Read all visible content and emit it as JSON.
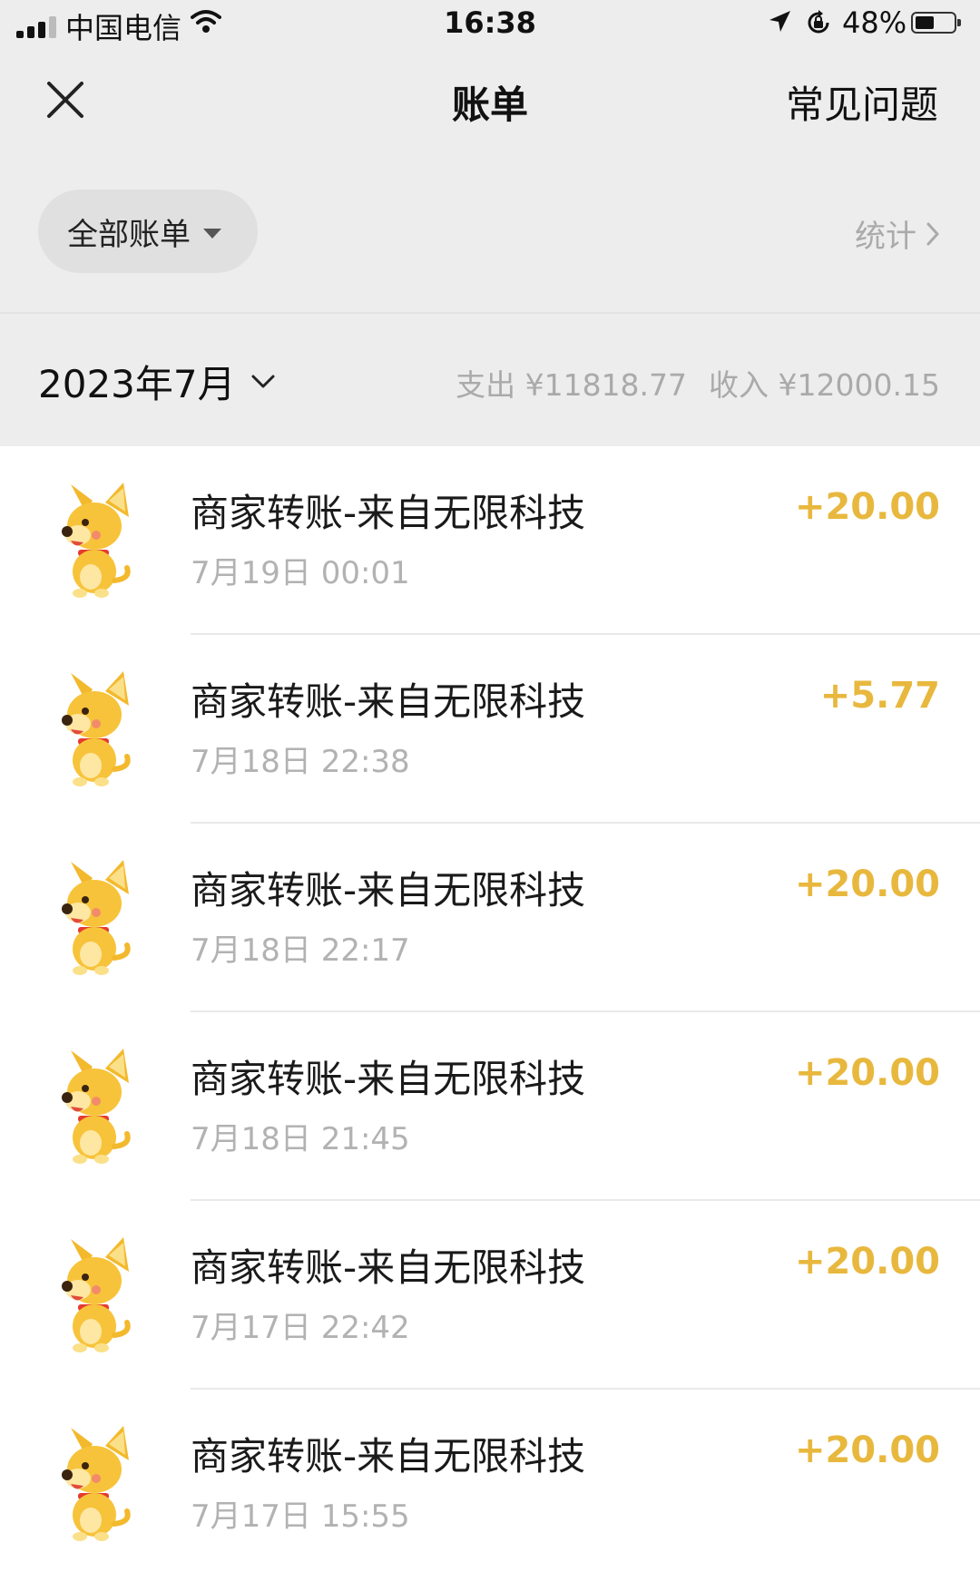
{
  "status_bar": {
    "carrier": "中国电信",
    "time": "16:38",
    "battery": "48%"
  },
  "nav": {
    "title": "账单",
    "faq": "常见问题"
  },
  "filter": {
    "label": "全部账单",
    "stats": "统计"
  },
  "month_bar": {
    "month": "2023年7月",
    "expense": "支出 ¥11818.77",
    "income": "收入 ¥12000.15"
  },
  "transactions": [
    {
      "title": "商家转账-来自无限科技",
      "time": "7月19日 00:01",
      "amount": "+20.00"
    },
    {
      "title": "商家转账-来自无限科技",
      "time": "7月18日 22:38",
      "amount": "+5.77"
    },
    {
      "title": "商家转账-来自无限科技",
      "time": "7月18日 22:17",
      "amount": "+20.00"
    },
    {
      "title": "商家转账-来自无限科技",
      "time": "7月18日 21:45",
      "amount": "+20.00"
    },
    {
      "title": "商家转账-来自无限科技",
      "time": "7月17日 22:42",
      "amount": "+20.00"
    },
    {
      "title": "商家转账-来自无限科技",
      "time": "7月17日 15:55",
      "amount": "+20.00"
    }
  ],
  "colors": {
    "income_amount": "#e8b83e",
    "header_bg": "#ededed",
    "muted_text": "#aaaaaa"
  },
  "icons": [
    "signal-icon",
    "wifi-icon",
    "location-arrow-icon",
    "rotation-lock-icon",
    "battery-icon",
    "close-icon",
    "chevron-right-icon",
    "chevron-down-icon",
    "dog-avatar-icon"
  ]
}
